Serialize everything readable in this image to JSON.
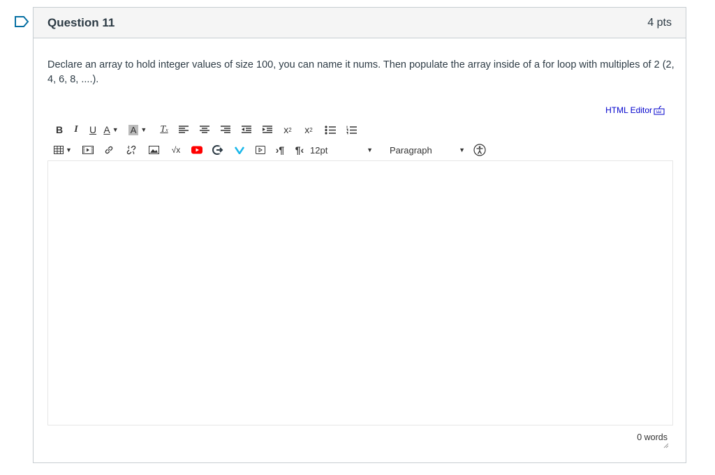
{
  "question": {
    "title": "Question 11",
    "points": "4 pts",
    "text": "Declare an array to hold integer values of size 100, you can name it nums. Then populate the array inside of a for loop with multiples of 2 (2, 4, 6, 8, ....)."
  },
  "editor": {
    "html_editor_link": "HTML Editor",
    "font_size": "12pt",
    "block_format": "Paragraph",
    "word_count": "0 words",
    "content": ""
  },
  "colors": {
    "accent_blue": "#0770a3",
    "link_blue": "#0000cc",
    "header_bg": "#f5f5f5",
    "youtube_red": "#ff0000",
    "vimeo_blue": "#1ab7ea"
  }
}
